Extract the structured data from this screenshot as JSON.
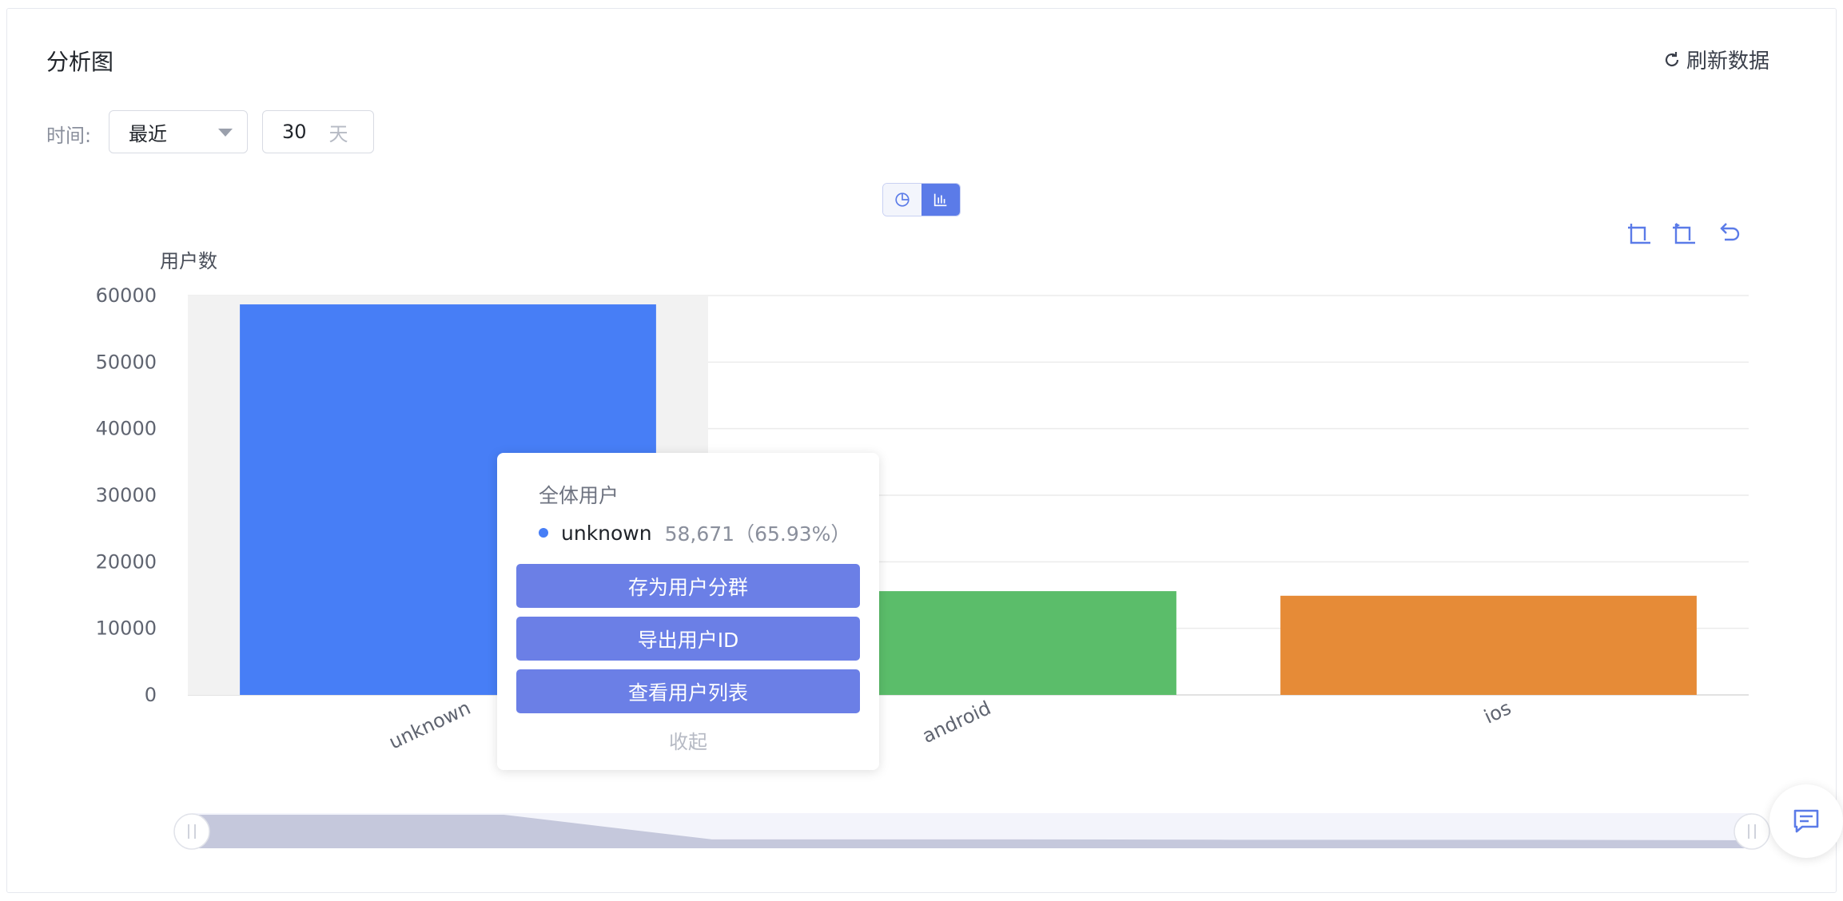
{
  "panel": {
    "title": "分析图",
    "refresh_label": "刷新数据"
  },
  "filters": {
    "time_label": "时间:",
    "range_select": "最近",
    "days_value": "30",
    "days_unit": "天"
  },
  "view_toggle": {
    "options": [
      "pie-chart-icon",
      "bar-chart-icon"
    ],
    "selected": "bar-chart-icon"
  },
  "toolbox": [
    "zoom-select-icon",
    "zoom-reset-icon",
    "undo-icon"
  ],
  "chart_data": {
    "type": "bar",
    "ylabel": "用户数",
    "xlabel": "",
    "categories": [
      "unknown",
      "android",
      "ios"
    ],
    "values": [
      58671,
      15590,
      14900
    ],
    "colors": [
      "#477ef6",
      "#5bbd6a",
      "#e68b37"
    ],
    "ylim": [
      0,
      60000
    ],
    "yticks": [
      "0",
      "10000",
      "20000",
      "30000",
      "40000",
      "50000",
      "60000"
    ],
    "grid": true,
    "highlighted_category": "unknown"
  },
  "tooltip": {
    "title": "全体用户",
    "series_name": "unknown",
    "value_text": "58,671（65.93%）",
    "buttons": [
      "存为用户分群",
      "导出用户ID",
      "查看用户列表"
    ],
    "collapse_label": "收起"
  },
  "slider": {
    "range": [
      0,
      100
    ]
  }
}
